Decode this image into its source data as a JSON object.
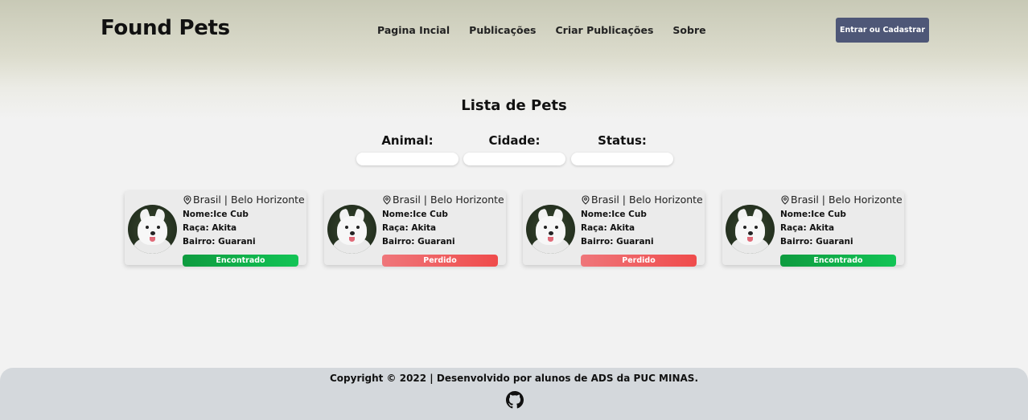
{
  "header": {
    "brand": "Found Pets",
    "nav": [
      "Pagina Incial",
      "Publicações",
      "Criar Publicações",
      "Sobre"
    ],
    "login_label": "Entrar ou Cadastrar"
  },
  "main": {
    "title": "Lista de Pets",
    "filters": [
      {
        "label": "Animal:",
        "value": ""
      },
      {
        "label": "Cidade:",
        "value": ""
      },
      {
        "label": "Status:",
        "value": ""
      }
    ],
    "pets": [
      {
        "location": "Brasil | Belo Horizonte",
        "name": "Nome:Ice Cub",
        "breed": "Raça: Akita",
        "district": "Bairro: Guarani",
        "status": "Encontrado",
        "status_color": "#12c455"
      },
      {
        "location": "Brasil | Belo Horizonte",
        "name": "Nome:Ice Cub",
        "breed": "Raça: Akita",
        "district": "Bairro: Guarani",
        "status": "Perdido",
        "status_color": "#ef4b4b"
      },
      {
        "location": "Brasil | Belo Horizonte",
        "name": "Nome:Ice Cub",
        "breed": "Raça: Akita",
        "district": "Bairro: Guarani",
        "status": "Perdido",
        "status_color": "#ef4b4b"
      },
      {
        "location": "Brasil | Belo Horizonte",
        "name": "Nome:Ice Cub",
        "breed": "Raça: Akita",
        "district": "Bairro: Guarani",
        "status": "Encontrado",
        "status_color": "#12c455"
      }
    ]
  },
  "footer": {
    "copyright": "Copyright © 2022 | Desenvolvido por alunos de ADS da PUC MINAS.",
    "icon": "github-icon"
  },
  "colors": {
    "login_button": "#4e5777",
    "found": "#12c455",
    "lost": "#ef4b4b",
    "footer_bg": "#d4d8dc"
  }
}
